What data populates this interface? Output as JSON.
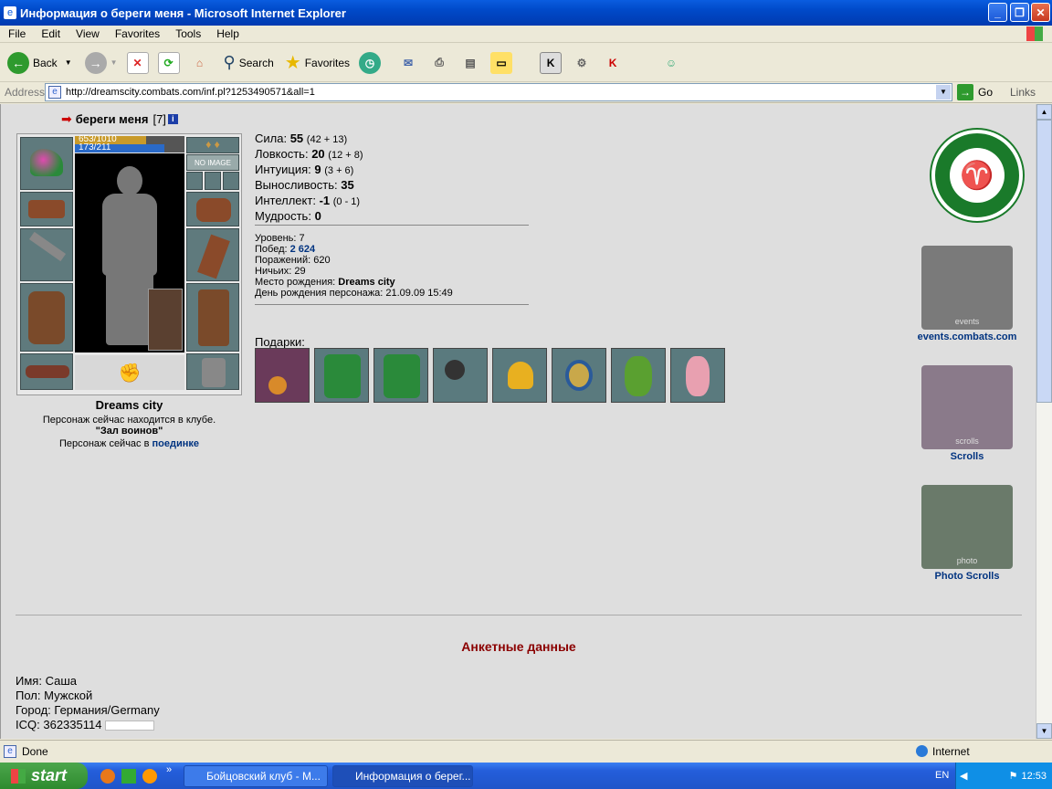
{
  "window": {
    "title": "Информация о береги меня - Microsoft Internet Explorer"
  },
  "menu": [
    "File",
    "Edit",
    "View",
    "Favorites",
    "Tools",
    "Help"
  ],
  "toolbar": {
    "back": "Back",
    "search": "Search",
    "favorites": "Favorites",
    "k_label": "K"
  },
  "address": {
    "label": "Address",
    "url": "http://dreamscity.combats.com/inf.pl?1253490571&all=1",
    "go": "Go",
    "links": "Links"
  },
  "character": {
    "name": "береги меня",
    "level": "[7]",
    "info_badge": "i",
    "hp": "653/1010",
    "mp": "173/211",
    "no_image": "NO IMAGE",
    "city": "Dreams city",
    "club_line": "Персонаж сейчас находится в клубе.",
    "club_room": "\"Зал воинов\"",
    "battle_prefix": "Персонаж сейчас в",
    "battle_link": "поединке"
  },
  "stats": [
    {
      "label": "Сила:",
      "value": "55",
      "detail": "(42 + 13)"
    },
    {
      "label": "Ловкость:",
      "value": "20",
      "detail": "(12 + 8)"
    },
    {
      "label": "Интуиция:",
      "value": "9",
      "detail": "(3 + 6)"
    },
    {
      "label": "Выносливость:",
      "value": "35",
      "detail": ""
    },
    {
      "label": "Интеллект:",
      "value": "-1",
      "detail": "(0 - 1)"
    },
    {
      "label": "Мудрость:",
      "value": "0",
      "detail": ""
    }
  ],
  "info": {
    "level_label": "Уровень:",
    "level": "7",
    "wins_label": "Побед:",
    "wins": "2 624",
    "losses_label": "Поражений:",
    "losses": "620",
    "draws_label": "Ничьих:",
    "draws": "29",
    "born_label": "Место рождения:",
    "born": "Dreams city",
    "birthday_label": "День рождения персонажа:",
    "birthday": "21.09.09 15:49"
  },
  "gifts_label": "Подарки:",
  "banners": [
    {
      "caption": "events.combats.com",
      "inner": "events"
    },
    {
      "caption": "Scrolls",
      "inner": "scrolls"
    },
    {
      "caption": "Photo Scrolls",
      "inner": "photo"
    }
  ],
  "profile": {
    "heading": "Анкетные данные",
    "name_label": "Имя:",
    "name": "Саша",
    "sex_label": "Пол:",
    "sex": "Мужской",
    "city_label": "Город:",
    "city": "Германия/Germany",
    "icq_label": "ICQ:",
    "icq": "362335114"
  },
  "status": {
    "text": "Done",
    "zone": "Internet"
  },
  "taskbar": {
    "start": "start",
    "task1": "Бойцовский клуб - M...",
    "task2": "Информация о берег...",
    "lang": "EN",
    "time": "12:53"
  },
  "colors": {
    "link": "#003380",
    "heading": "#8b0000",
    "title_bar": "#0a5de0",
    "taskbar": "#245edb"
  }
}
